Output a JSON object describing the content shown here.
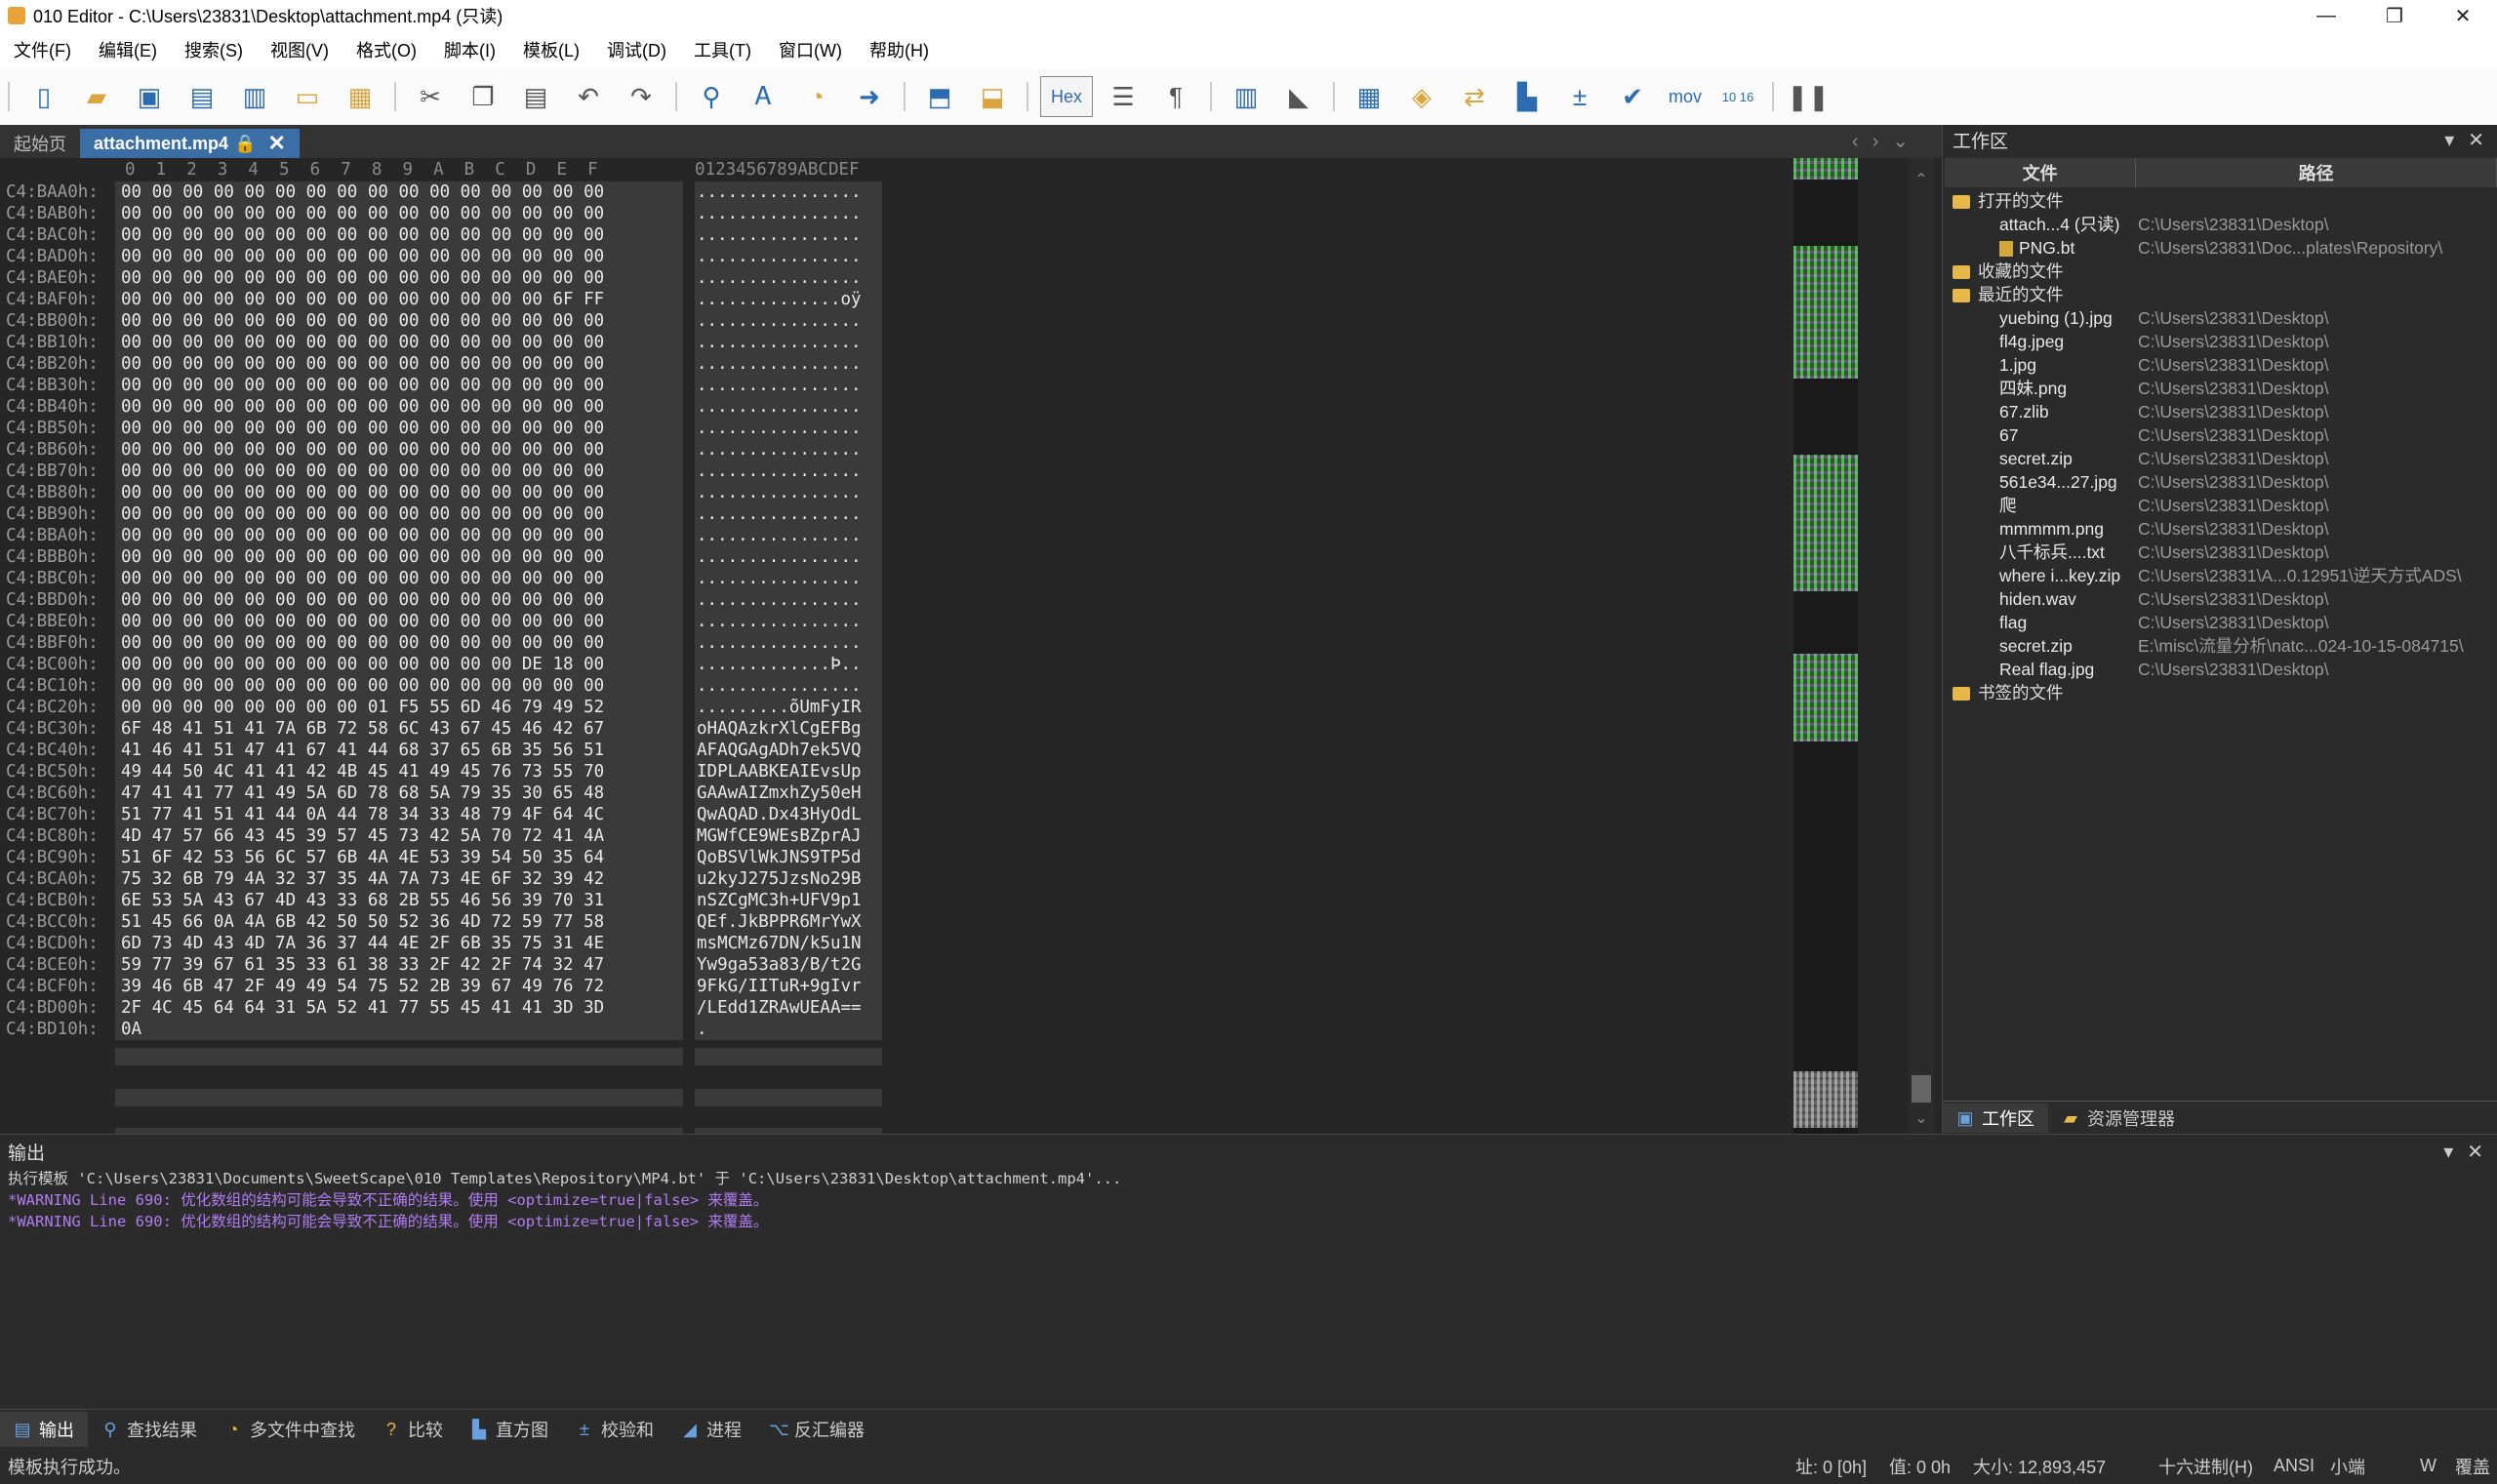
{
  "window": {
    "title": "010 Editor - C:\\Users\\23831\\Desktop\\attachment.mp4 (只读)",
    "minimize": "—",
    "maximize": "❐",
    "close": "✕"
  },
  "menu": [
    "文件(F)",
    "编辑(E)",
    "搜索(S)",
    "视图(V)",
    "格式(O)",
    "脚本(I)",
    "模板(L)",
    "调试(D)",
    "工具(T)",
    "窗口(W)",
    "帮助(H)"
  ],
  "toolbar": {
    "hex_label": "Hex",
    "mov_label": "mov",
    "base_label": "10 16"
  },
  "tabs": {
    "start": "起始页",
    "file": "attachment.mp4"
  },
  "hex": {
    "column_header": "0  1  2  3  4  5  6  7  8  9  A  B  C  D  E  F",
    "ascii_header": "0123456789ABCDEF",
    "rows": [
      {
        "addr": "C4:BAA0h:",
        "bytes": "00 00 00 00 00 00 00 00 00 00 00 00 00 00 00 00",
        "ascii": "................"
      },
      {
        "addr": "C4:BAB0h:",
        "bytes": "00 00 00 00 00 00 00 00 00 00 00 00 00 00 00 00",
        "ascii": "................"
      },
      {
        "addr": "C4:BAC0h:",
        "bytes": "00 00 00 00 00 00 00 00 00 00 00 00 00 00 00 00",
        "ascii": "................"
      },
      {
        "addr": "C4:BAD0h:",
        "bytes": "00 00 00 00 00 00 00 00 00 00 00 00 00 00 00 00",
        "ascii": "................"
      },
      {
        "addr": "C4:BAE0h:",
        "bytes": "00 00 00 00 00 00 00 00 00 00 00 00 00 00 00 00",
        "ascii": "................"
      },
      {
        "addr": "C4:BAF0h:",
        "bytes": "00 00 00 00 00 00 00 00 00 00 00 00 00 00 6F FF",
        "ascii": "..............oÿ"
      },
      {
        "addr": "C4:BB00h:",
        "bytes": "00 00 00 00 00 00 00 00 00 00 00 00 00 00 00 00",
        "ascii": "................"
      },
      {
        "addr": "C4:BB10h:",
        "bytes": "00 00 00 00 00 00 00 00 00 00 00 00 00 00 00 00",
        "ascii": "................"
      },
      {
        "addr": "C4:BB20h:",
        "bytes": "00 00 00 00 00 00 00 00 00 00 00 00 00 00 00 00",
        "ascii": "................"
      },
      {
        "addr": "C4:BB30h:",
        "bytes": "00 00 00 00 00 00 00 00 00 00 00 00 00 00 00 00",
        "ascii": "................"
      },
      {
        "addr": "C4:BB40h:",
        "bytes": "00 00 00 00 00 00 00 00 00 00 00 00 00 00 00 00",
        "ascii": "................"
      },
      {
        "addr": "C4:BB50h:",
        "bytes": "00 00 00 00 00 00 00 00 00 00 00 00 00 00 00 00",
        "ascii": "................"
      },
      {
        "addr": "C4:BB60h:",
        "bytes": "00 00 00 00 00 00 00 00 00 00 00 00 00 00 00 00",
        "ascii": "................"
      },
      {
        "addr": "C4:BB70h:",
        "bytes": "00 00 00 00 00 00 00 00 00 00 00 00 00 00 00 00",
        "ascii": "................"
      },
      {
        "addr": "C4:BB80h:",
        "bytes": "00 00 00 00 00 00 00 00 00 00 00 00 00 00 00 00",
        "ascii": "................"
      },
      {
        "addr": "C4:BB90h:",
        "bytes": "00 00 00 00 00 00 00 00 00 00 00 00 00 00 00 00",
        "ascii": "................"
      },
      {
        "addr": "C4:BBA0h:",
        "bytes": "00 00 00 00 00 00 00 00 00 00 00 00 00 00 00 00",
        "ascii": "................"
      },
      {
        "addr": "C4:BBB0h:",
        "bytes": "00 00 00 00 00 00 00 00 00 00 00 00 00 00 00 00",
        "ascii": "................"
      },
      {
        "addr": "C4:BBC0h:",
        "bytes": "00 00 00 00 00 00 00 00 00 00 00 00 00 00 00 00",
        "ascii": "................"
      },
      {
        "addr": "C4:BBD0h:",
        "bytes": "00 00 00 00 00 00 00 00 00 00 00 00 00 00 00 00",
        "ascii": "................"
      },
      {
        "addr": "C4:BBE0h:",
        "bytes": "00 00 00 00 00 00 00 00 00 00 00 00 00 00 00 00",
        "ascii": "................"
      },
      {
        "addr": "C4:BBF0h:",
        "bytes": "00 00 00 00 00 00 00 00 00 00 00 00 00 00 00 00",
        "ascii": "................"
      },
      {
        "addr": "C4:BC00h:",
        "bytes": "00 00 00 00 00 00 00 00 00 00 00 00 00 DE 18 00",
        "ascii": ".............Þ.."
      },
      {
        "addr": "C4:BC10h:",
        "bytes": "00 00 00 00 00 00 00 00 00 00 00 00 00 00 00 00",
        "ascii": "................"
      },
      {
        "addr": "C4:BC20h:",
        "bytes": "00 00 00 00 00 00 00 00 01 F5 55 6D 46 79 49 52",
        "ascii": ".........õUmFyIR"
      },
      {
        "addr": "C4:BC30h:",
        "bytes": "6F 48 41 51 41 7A 6B 72 58 6C 43 67 45 46 42 67",
        "ascii": "oHAQAzkrXlCgEFBg"
      },
      {
        "addr": "C4:BC40h:",
        "bytes": "41 46 41 51 47 41 67 41 44 68 37 65 6B 35 56 51",
        "ascii": "AFAQGAgADh7ek5VQ"
      },
      {
        "addr": "C4:BC50h:",
        "bytes": "49 44 50 4C 41 41 42 4B 45 41 49 45 76 73 55 70",
        "ascii": "IDPLAABKEAIEvsUp"
      },
      {
        "addr": "C4:BC60h:",
        "bytes": "47 41 41 77 41 49 5A 6D 78 68 5A 79 35 30 65 48",
        "ascii": "GAAwAIZmxhZy50eH"
      },
      {
        "addr": "C4:BC70h:",
        "bytes": "51 77 41 51 41 44 0A 44 78 34 33 48 79 4F 64 4C",
        "ascii": "QwAQAD.Dx43HyOdL"
      },
      {
        "addr": "C4:BC80h:",
        "bytes": "4D 47 57 66 43 45 39 57 45 73 42 5A 70 72 41 4A",
        "ascii": "MGWfCE9WEsBZprAJ"
      },
      {
        "addr": "C4:BC90h:",
        "bytes": "51 6F 42 53 56 6C 57 6B 4A 4E 53 39 54 50 35 64",
        "ascii": "QoBSVlWkJNS9TP5d"
      },
      {
        "addr": "C4:BCA0h:",
        "bytes": "75 32 6B 79 4A 32 37 35 4A 7A 73 4E 6F 32 39 42",
        "ascii": "u2kyJ275JzsNo29B"
      },
      {
        "addr": "C4:BCB0h:",
        "bytes": "6E 53 5A 43 67 4D 43 33 68 2B 55 46 56 39 70 31",
        "ascii": "nSZCgMC3h+UFV9p1"
      },
      {
        "addr": "C4:BCC0h:",
        "bytes": "51 45 66 0A 4A 6B 42 50 50 52 36 4D 72 59 77 58",
        "ascii": "QEf.JkBPPR6MrYwX"
      },
      {
        "addr": "C4:BCD0h:",
        "bytes": "6D 73 4D 43 4D 7A 36 37 44 4E 2F 6B 35 75 31 4E",
        "ascii": "msMCMz67DN/k5u1N"
      },
      {
        "addr": "C4:BCE0h:",
        "bytes": "59 77 39 67 61 35 33 61 38 33 2F 42 2F 74 32 47",
        "ascii": "Yw9ga53a83/B/t2G"
      },
      {
        "addr": "C4:BCF0h:",
        "bytes": "39 46 6B 47 2F 49 49 54 75 52 2B 39 67 49 76 72",
        "ascii": "9FkG/IITuR+9gIvr"
      },
      {
        "addr": "C4:BD00h:",
        "bytes": "2F 4C 45 64 64 31 5A 52 41 77 55 45 41 41 3D 3D",
        "ascii": "/LEdd1ZRAwUEAA=="
      },
      {
        "addr": "C4:BD10h:",
        "bytes": "0A",
        "ascii": "."
      }
    ]
  },
  "workspace": {
    "title": "工作区",
    "col_file": "文件",
    "col_path": "路径",
    "open_files_label": "打开的文件",
    "open_files": [
      {
        "name": "attach...4 (只读)",
        "path": "C:\\Users\\23831\\Desktop\\"
      },
      {
        "name": "PNG.bt",
        "path": "C:\\Users\\23831\\Doc...plates\\Repository\\"
      }
    ],
    "favorites_label": "收藏的文件",
    "recent_label": "最近的文件",
    "recent_files": [
      {
        "name": "yuebing (1).jpg",
        "path": "C:\\Users\\23831\\Desktop\\"
      },
      {
        "name": "fl4g.jpeg",
        "path": "C:\\Users\\23831\\Desktop\\"
      },
      {
        "name": "1.jpg",
        "path": "C:\\Users\\23831\\Desktop\\"
      },
      {
        "name": "四妹.png",
        "path": "C:\\Users\\23831\\Desktop\\"
      },
      {
        "name": "67.zlib",
        "path": "C:\\Users\\23831\\Desktop\\"
      },
      {
        "name": "67",
        "path": "C:\\Users\\23831\\Desktop\\"
      },
      {
        "name": "secret.zip",
        "path": "C:\\Users\\23831\\Desktop\\"
      },
      {
        "name": "561e34...27.jpg",
        "path": "C:\\Users\\23831\\Desktop\\"
      },
      {
        "name": "爬",
        "path": "C:\\Users\\23831\\Desktop\\"
      },
      {
        "name": "mmmmm.png",
        "path": "C:\\Users\\23831\\Desktop\\"
      },
      {
        "name": "八千标兵....txt",
        "path": "C:\\Users\\23831\\Desktop\\"
      },
      {
        "name": "where i...key.zip",
        "path": "C:\\Users\\23831\\A...0.12951\\逆天方式ADS\\"
      },
      {
        "name": "hiden.wav",
        "path": "C:\\Users\\23831\\Desktop\\"
      },
      {
        "name": "flag",
        "path": "C:\\Users\\23831\\Desktop\\"
      },
      {
        "name": "secret.zip",
        "path": "E:\\misc\\流量分析\\natc...024-10-15-084715\\"
      },
      {
        "name": "Real flag.jpg",
        "path": "C:\\Users\\23831\\Desktop\\"
      }
    ],
    "bookmarks_label": "书签的文件",
    "tab_workspace": "工作区",
    "tab_explorer": "资源管理器"
  },
  "output": {
    "title": "输出",
    "lines": [
      "执行模板 'C:\\Users\\23831\\Documents\\SweetScape\\010 Templates\\Repository\\MP4.bt' 于 'C:\\Users\\23831\\Desktop\\attachment.mp4'...",
      "*WARNING Line 690: 优化数组的结构可能会导致不正确的结果。使用 <optimize=true|false> 来覆盖。",
      "*WARNING Line 690: 优化数组的结构可能会导致不正确的结果。使用 <optimize=true|false> 来覆盖。"
    ]
  },
  "bottom_tabs": [
    "输出",
    "查找结果",
    "多文件中查找",
    "比较",
    "直方图",
    "校验和",
    "进程",
    "反汇编器"
  ],
  "status": {
    "message": "模板执行成功。",
    "address": "址: 0 [0h]",
    "value": "值: 0 0h",
    "size": "大小: 12,893,457",
    "mode": "十六进制(H)",
    "charset": "ANSI",
    "endian": "小端",
    "write": "W",
    "overwrite": "覆盖"
  }
}
